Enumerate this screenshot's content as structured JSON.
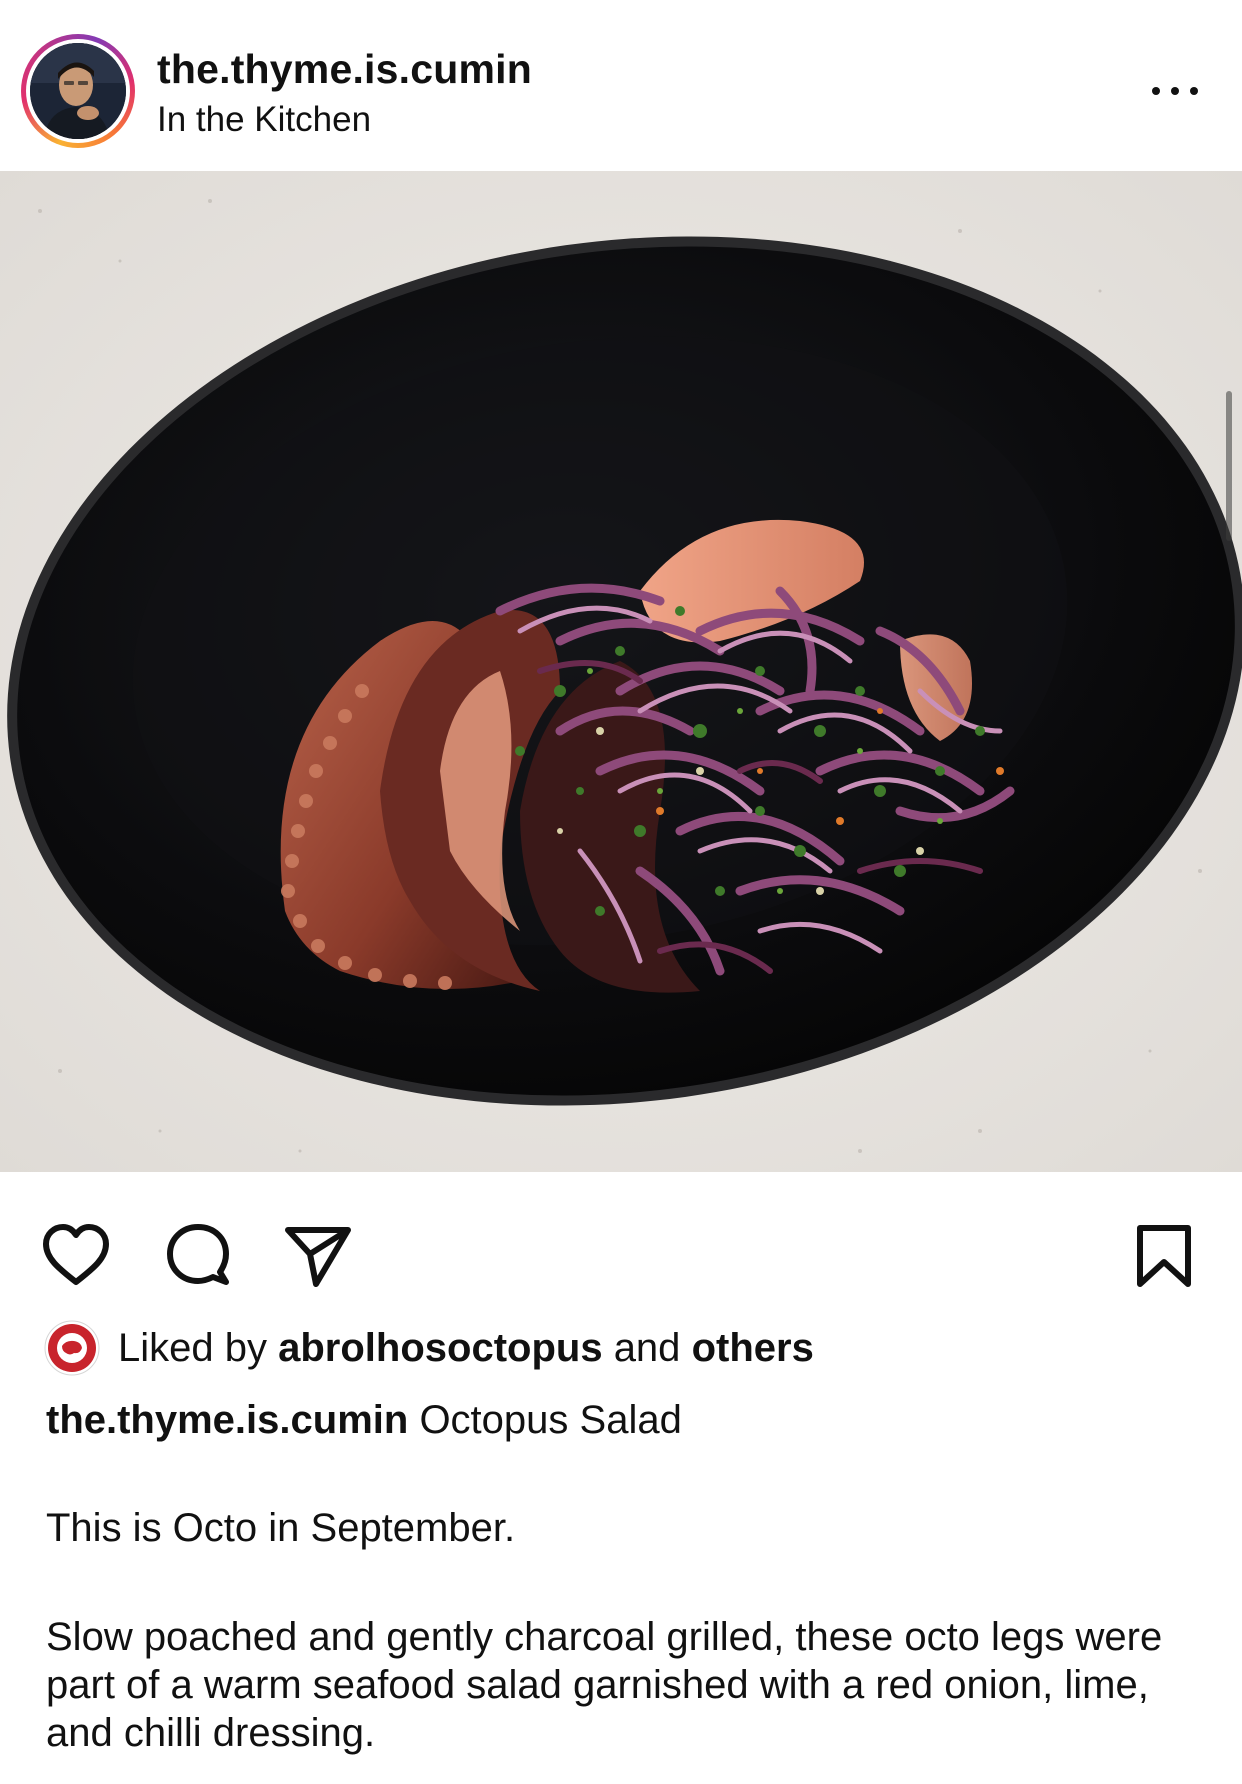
{
  "post": {
    "username": "the.thyme.is.cumin",
    "location": "In the Kitchen"
  },
  "icons": {
    "avatar": "profile-photo",
    "more": "ellipsis-icon",
    "like": "heart-icon",
    "comment": "comment-bubble-icon",
    "share": "paper-plane-icon",
    "save": "bookmark-icon",
    "liker_badge": "australian-seafood-logo"
  },
  "likes": {
    "prefix": "Liked by",
    "user": "abrolhosoctopus",
    "conj": "and",
    "others": "others"
  },
  "caption": {
    "username": "the.thyme.is.cumin",
    "title": "Octopus Salad",
    "line1": "This is Octo in September.",
    "line2": "Slow poached and gently charcoal grilled, these octo legs were part of a warm seafood salad garnished with a red onion, lime, and chilli dressing."
  },
  "colors": {
    "text": "#111111",
    "plate": "#0d0d0e",
    "counter": "#e9e6e2",
    "ring_pink": "#e1306c",
    "ring_orange": "#f9b233"
  }
}
